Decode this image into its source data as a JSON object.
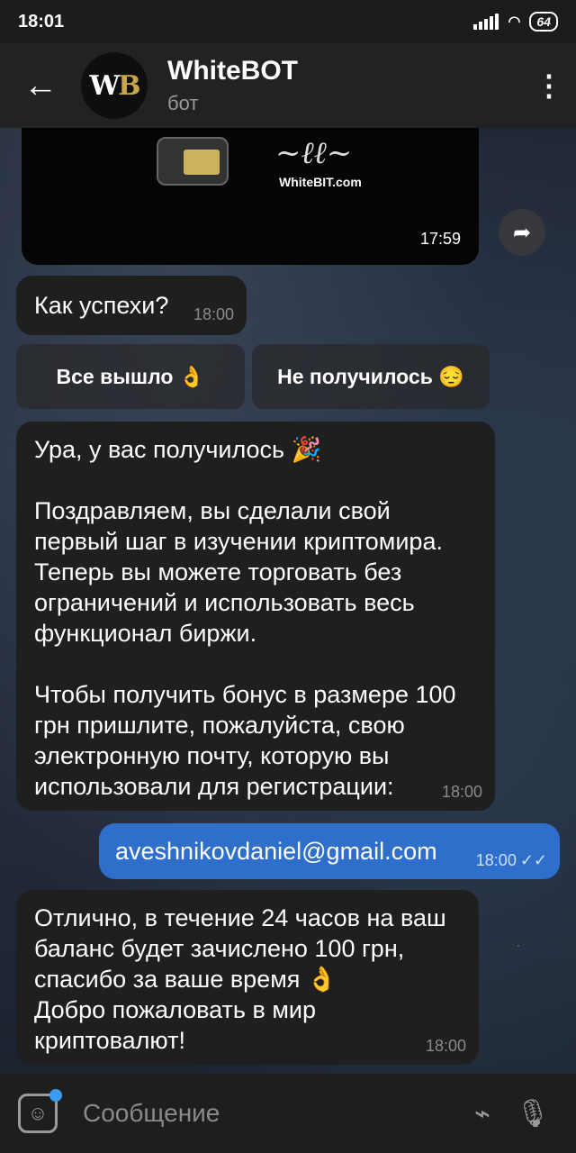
{
  "status": {
    "time": "18:01",
    "battery": "64"
  },
  "header": {
    "title": "WhiteBOT",
    "subtitle": "бот",
    "avatar_text": "WB"
  },
  "media": {
    "brand": "WhiteBIT.com",
    "time": "17:59"
  },
  "messages": {
    "m1": {
      "text": "Как успехи?",
      "time": "18:00"
    },
    "kb1": "Все вышло 👌",
    "kb2": "Не получилось 😔",
    "m2": {
      "text": "Ура, у вас получилось 🎉\n\nПоздравляем, вы сделали свой первый шаг в изучении криптомира. Теперь вы можете торговать без ограничений и использовать весь функционал биржи.\n\nЧтобы получить бонус в размере 100 грн пришлите, пожалуйста, свою электронную почту, которую вы использовали для регистрации:",
      "time": "18:00"
    },
    "m3": {
      "text": "aveshnikovdaniel@gmail.com",
      "time": "18:00"
    },
    "m4": {
      "text": "Отлично, в течение 24 часов на ваш баланс будет зачислено 100 грн, спасибо за ваше время 👌\nДобро пожаловать в мир криптовалют!",
      "time": "18:00"
    }
  },
  "input": {
    "placeholder": "Сообщение"
  },
  "colors": {
    "accent": "#3a9bf0",
    "outgoing_bubble": "#2f6fcc",
    "incoming_bubble": "#1f1f1f"
  }
}
